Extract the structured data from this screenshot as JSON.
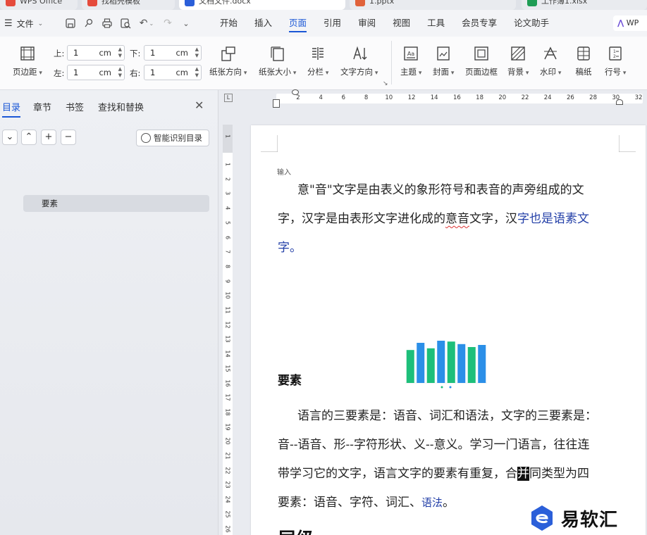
{
  "tabs": [
    {
      "label": "WPS Office",
      "color": "#e54b3c"
    },
    {
      "label": "找稻壳模板",
      "color": "#e54b3c"
    },
    {
      "label": "文档文件.docx",
      "color": "#2b5fd9"
    },
    {
      "label": "1.pptx",
      "color": "#e0623a"
    },
    {
      "label": "工作簿1.xlsx",
      "color": "#1f9d55"
    }
  ],
  "menubar": {
    "file_label": "文件",
    "tabs": [
      "开始",
      "插入",
      "页面",
      "引用",
      "审阅",
      "视图",
      "工具",
      "会员专享",
      "论文助手"
    ],
    "active_tab": "页面",
    "right_label": "WP"
  },
  "ribbon": {
    "margins": {
      "label": "页边距"
    },
    "top": {
      "label": "上:",
      "value": "1",
      "unit": "cm"
    },
    "bottom": {
      "label": "下:",
      "value": "1",
      "unit": "cm"
    },
    "left": {
      "label": "左:",
      "value": "1",
      "unit": "cm"
    },
    "right": {
      "label": "右:",
      "value": "1",
      "unit": "cm"
    },
    "orientation": "纸张方向",
    "size": "纸张大小",
    "columns": "分栏",
    "text_direction": "文字方向",
    "theme": "主题",
    "cover": "封面",
    "page_border": "页面边框",
    "background": "背景",
    "watermark": "水印",
    "manuscript": "稿纸",
    "line_number": "行号"
  },
  "nav": {
    "tabs": [
      "目录",
      "章节",
      "书签",
      "查找和替换"
    ],
    "active_tab": "目录",
    "smart_toc": "智能识别目录",
    "toc_items": [
      "要素"
    ]
  },
  "ruler": {
    "h_ticks": [
      "2",
      "4",
      "6",
      "8",
      "10",
      "12",
      "14",
      "16",
      "18",
      "20",
      "22",
      "24",
      "26",
      "28",
      "30",
      "32"
    ],
    "v_ticks": [
      "1",
      "1",
      "2",
      "3",
      "4",
      "5",
      "6",
      "7",
      "8",
      "9",
      "10",
      "11",
      "12",
      "13",
      "14",
      "15",
      "16",
      "17",
      "18",
      "19",
      "20",
      "21",
      "22",
      "23",
      "24",
      "25",
      "26"
    ]
  },
  "doc": {
    "hint": "输入",
    "p1_l1": "意\"音\"文字是由表义的象形符号和表音的声旁组成的文",
    "p1_l2a": "字，汉字是由表形文字进化成的",
    "p1_l2b": "意音",
    "p1_l2c": "文字，汉",
    "p1_l2d": "字也是语素文",
    "p1_l3": "字。",
    "heading": "要素",
    "p2_l1": "语言的三要素是：语音、词汇和语法，文字的三要素是：",
    "p2_l2": "音--语音、形--字符形状、义--意义。学习一门语言，往往连",
    "p2_l3a": "带学习它的文字，语言文字的要素有重复，合",
    "p2_l3b": "并",
    "p2_l3c": "同类型为四",
    "p2_l4a": "要素：语音、字符、词汇、",
    "p2_l4b": "语法",
    "p2_l4c": "。",
    "heading2": "层级"
  },
  "chart_data": {
    "type": "bar",
    "categories": [
      "",
      "",
      "",
      "",
      "",
      "",
      "",
      ""
    ],
    "series": [
      {
        "name": "",
        "values": [
          78,
          95,
          82,
          100,
          98,
          92,
          85,
          90
        ],
        "colors": [
          "#1dbf7a",
          "#2b8fe8",
          "#1dbf7a",
          "#2b8fe8",
          "#1dbf7a",
          "#2b8fe8",
          "#1dbf7a",
          "#2b8fe8"
        ]
      }
    ],
    "ylim": [
      0,
      110
    ],
    "legend": "bottom",
    "grid": false
  },
  "watermark": {
    "text": "易软汇",
    "color": "#2b5fd9"
  }
}
